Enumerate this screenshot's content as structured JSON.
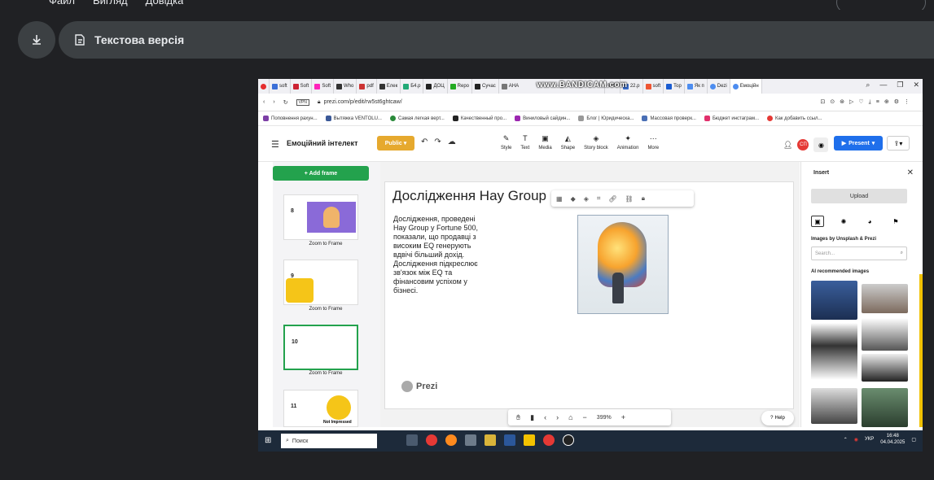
{
  "viewer": {
    "menu": [
      "Файл",
      "Вигляд",
      "Довідка"
    ],
    "text_version_label": "Текстова версія",
    "download_icon": "download-icon",
    "text_icon": "document-text-icon"
  },
  "browser": {
    "tabs": [
      "soft",
      "Soft",
      "Soft",
      "Who",
      "pdf",
      "Елек",
      "Б4.р",
      "ДОЦ",
      "Repo",
      "Сучас",
      "АНА",
      "316-",
      "22.р",
      "soft",
      "Top",
      "Як п",
      "Dezi",
      "Емоційн"
    ],
    "watermark": "www.BANDICAM.com",
    "url": "prezi.com/p/edit/rw5st6ghtcaw/",
    "bookmarks": [
      "Поповнення рахун...",
      "Вытяжка VENTOLU...",
      "Самая легкая верт...",
      "Качественный про...",
      "Виниловый сайдин...",
      "Блог | Юридическа...",
      "Массовая проверк...",
      "Бюджет инстаграм...",
      "Как добавить ссыл..."
    ]
  },
  "app": {
    "title": "Емоційний інтелект",
    "public_label": "Public",
    "tools": [
      "Style",
      "Text",
      "Media",
      "Shape",
      "Story block",
      "Animation",
      "More"
    ],
    "present_label": "Present",
    "avatar_initials": "СП",
    "add_frame_label": "+ Add frame",
    "frames": [
      {
        "num": "8",
        "zoom": "Zoom to Frame"
      },
      {
        "num": "9",
        "zoom": "Zoom to Frame"
      },
      {
        "num": "10",
        "zoom": "Zoom to Frame"
      },
      {
        "num": "11",
        "zoom": "Not Impressed"
      }
    ],
    "slide": {
      "title": "Дослідження Hay Group",
      "body": "Дослідження, проведені Hay Group у Fortune 500, показали, що продавці з високим EQ генерують вдвічі більший дохід. Дослідження підкреслює зв'язок між EQ та фінансовим успіхом у бізнесі.",
      "logo": "Prezi"
    },
    "zoom_level": "399%",
    "help_label": "Help",
    "insert": {
      "title": "Insert",
      "upload_label": "Upload",
      "images_by": "Images by Unsplash & Prezi",
      "search_placeholder": "Search...",
      "ai_label": "AI recommended images"
    }
  },
  "taskbar": {
    "search_label": "Поиск",
    "lang": "УКР",
    "time": "16:48",
    "date": "04.04.2025"
  }
}
